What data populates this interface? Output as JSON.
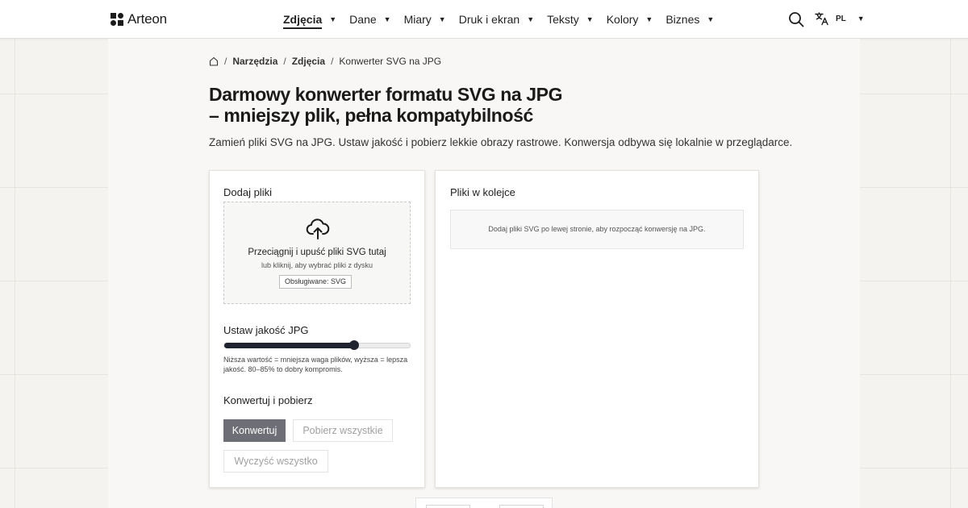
{
  "header": {
    "logo_text": "Arteon",
    "nav": [
      {
        "label": "Zdjęcia",
        "active": true
      },
      {
        "label": "Dane",
        "active": false
      },
      {
        "label": "Miary",
        "active": false
      },
      {
        "label": "Druk i ekran",
        "active": false
      },
      {
        "label": "Teksty",
        "active": false
      },
      {
        "label": "Kolory",
        "active": false
      },
      {
        "label": "Biznes",
        "active": false
      }
    ],
    "caret": "▼",
    "language": "PL"
  },
  "breadcrumb": {
    "items": [
      "Narzędzia",
      "Zdjęcia"
    ],
    "current": "Konwerter SVG na JPG",
    "separator": "/"
  },
  "page": {
    "title_line1": "Darmowy konwerter formatu SVG na JPG",
    "title_line2": "– mniejszy plik, pełna kompatybilność",
    "subtitle": "Zamień pliki SVG na JPG. Ustaw jakość i pobierz lekkie obrazy rastrowe. Konwersja odbywa się lokalnie w przeglądarce."
  },
  "upload": {
    "section_title": "Dodaj pliki",
    "drop_title": "Przeciągnij i upuść pliki SVG tutaj",
    "drop_sub": "lub kliknij, aby wybrać pliki z dysku",
    "supported": "Obsługiwane: SVG"
  },
  "quality": {
    "section_title": "Ustaw jakość JPG",
    "value_fraction": 0.7,
    "hint": "Niższa wartość = mniejsza waga plików, wyższa = lepsza jakość. 80–85% to dobry kompromis."
  },
  "actions": {
    "section_title": "Konwertuj i pobierz",
    "convert": "Konwertuj",
    "download_all": "Pobierz wszystkie",
    "clear_all": "Wyczyść wszystko"
  },
  "queue": {
    "section_title": "Pliki w kolejce",
    "empty_text": "Dodaj pliki SVG po lewej stronie, aby rozpocząć konwersję na JPG."
  },
  "colors": {
    "accent": "#1f2330",
    "primary_button": "#6e6e76"
  }
}
